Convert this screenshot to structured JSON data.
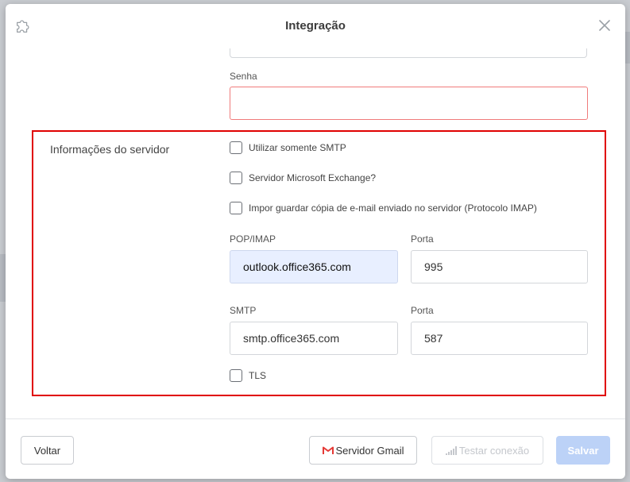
{
  "modal": {
    "title": "Integração",
    "icon": "puzzle-icon",
    "close_icon": "close-icon"
  },
  "auth": {
    "password_label": "Senha",
    "password_value": ""
  },
  "server": {
    "section_title": "Informações do servidor",
    "options": [
      {
        "label": "Utilizar somente SMTP",
        "checked": false
      },
      {
        "label": "Servidor Microsoft Exchange?",
        "checked": false
      },
      {
        "label": "Impor guardar cópia de e-mail enviado no servidor (Protocolo IMAP)",
        "checked": false
      }
    ],
    "pop_label": "POP/IMAP",
    "pop_value": "outlook.office365.com",
    "pop_port_label": "Porta",
    "pop_port_value": "995",
    "smtp_label": "SMTP",
    "smtp_value": "smtp.office365.com",
    "smtp_port_label": "Porta",
    "smtp_port_value": "587",
    "tls_label": "TLS",
    "tls_checked": false
  },
  "footer": {
    "back_label": "Voltar",
    "gmail_label": "Servidor Gmail",
    "test_label": "Testar conexão",
    "save_label": "Salvar"
  },
  "colors": {
    "highlight": "#e00000",
    "error_border": "#f07b7b",
    "save_button": "#bcd2f7",
    "gmail_red": "#e53935"
  }
}
